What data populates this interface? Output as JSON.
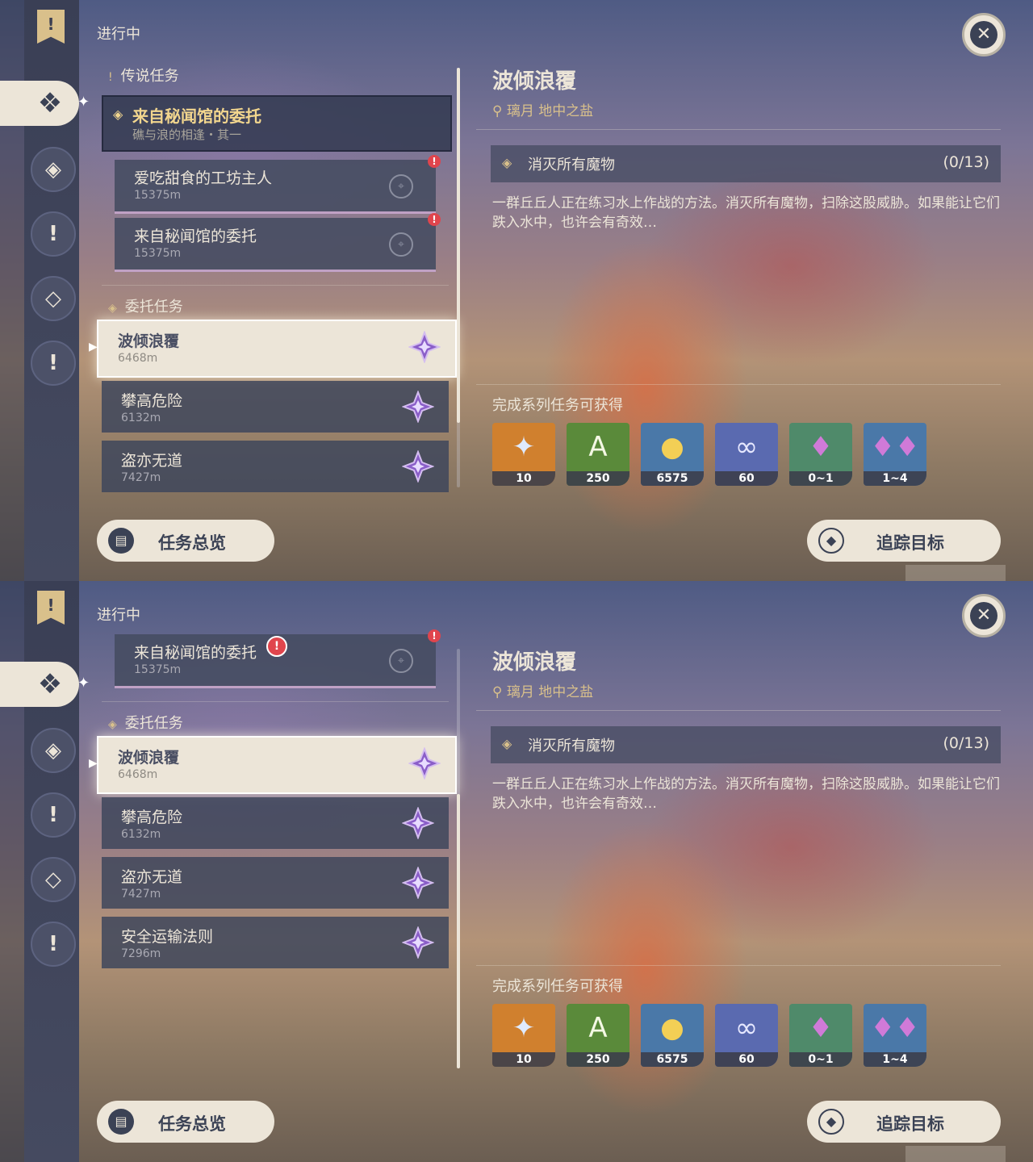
{
  "frames": [
    {
      "section_header": "进行中",
      "legend_category": "传说任务",
      "legend_quest": {
        "title": "来自秘闻馆的委托",
        "subtitle": "礁与浪的相逢・其一"
      },
      "sub_quests": [
        {
          "title": "爱吃甜食的工坊主人",
          "distance": "15375m"
        },
        {
          "title": "来自秘闻馆的委托",
          "distance": "15375m"
        }
      ],
      "commission_category": "委托任务",
      "commissions": [
        {
          "title": "波倾浪覆",
          "distance": "6468m",
          "selected": true
        },
        {
          "title": "攀高危险",
          "distance": "6132m"
        },
        {
          "title": "盗亦无道",
          "distance": "7427m"
        }
      ]
    },
    {
      "section_header": "进行中",
      "sub_quests": [
        {
          "title": "来自秘闻馆的委托",
          "distance": "15375m"
        }
      ],
      "commission_category": "委托任务",
      "commissions": [
        {
          "title": "波倾浪覆",
          "distance": "6468m",
          "selected": true
        },
        {
          "title": "攀高危险",
          "distance": "6132m"
        },
        {
          "title": "盗亦无道",
          "distance": "7427m"
        },
        {
          "title": "安全运输法则",
          "distance": "7296m"
        }
      ]
    }
  ],
  "detail": {
    "title": "波倾浪覆",
    "location": "璃月 地中之盐",
    "objective": "消灭所有魔物",
    "progress": "(0/13)",
    "description": "一群丘丘人正在练习水上作战的方法。消灭所有魔物，扫除这股威胁。如果能让它们跌入水中，也许会有奇效…",
    "rewards_header": "完成系列任务可获得",
    "rewards": [
      {
        "icon": "primogem-icon",
        "count": "10",
        "bg": "#d0802e"
      },
      {
        "icon": "adventure-exp-icon",
        "count": "250",
        "bg": "#5a8a3a"
      },
      {
        "icon": "mora-icon",
        "count": "6575",
        "bg": "#4a78a8"
      },
      {
        "icon": "friendship-exp-icon",
        "count": "60",
        "bg": "#5a6ab0"
      },
      {
        "icon": "crystal-icon",
        "count": "0~1",
        "bg": "#4f8a6a"
      },
      {
        "icon": "crystal-cluster-icon",
        "count": "1~4",
        "bg": "#4a78a8"
      }
    ]
  },
  "buttons": {
    "overview": "任务总览",
    "track": "追踪目标"
  },
  "colors": {
    "accent_gold": "#d9c08b",
    "cream": "#ece5d8",
    "dark": "#3b4255",
    "alert": "#e0454d"
  }
}
